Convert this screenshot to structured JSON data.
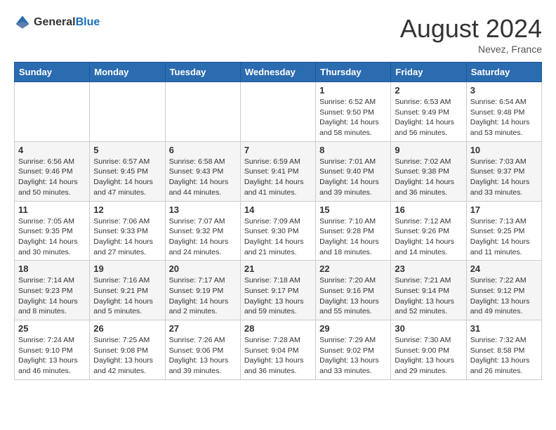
{
  "logo": {
    "general": "General",
    "blue": "Blue"
  },
  "header": {
    "month_year": "August 2024",
    "location": "Nevez, France"
  },
  "weekdays": [
    "Sunday",
    "Monday",
    "Tuesday",
    "Wednesday",
    "Thursday",
    "Friday",
    "Saturday"
  ],
  "weeks": [
    [
      {
        "day": "",
        "info": ""
      },
      {
        "day": "",
        "info": ""
      },
      {
        "day": "",
        "info": ""
      },
      {
        "day": "",
        "info": ""
      },
      {
        "day": "1",
        "info": "Sunrise: 6:52 AM\nSunset: 9:50 PM\nDaylight: 14 hours\nand 58 minutes."
      },
      {
        "day": "2",
        "info": "Sunrise: 6:53 AM\nSunset: 9:49 PM\nDaylight: 14 hours\nand 56 minutes."
      },
      {
        "day": "3",
        "info": "Sunrise: 6:54 AM\nSunset: 9:48 PM\nDaylight: 14 hours\nand 53 minutes."
      }
    ],
    [
      {
        "day": "4",
        "info": "Sunrise: 6:56 AM\nSunset: 9:46 PM\nDaylight: 14 hours\nand 50 minutes."
      },
      {
        "day": "5",
        "info": "Sunrise: 6:57 AM\nSunset: 9:45 PM\nDaylight: 14 hours\nand 47 minutes."
      },
      {
        "day": "6",
        "info": "Sunrise: 6:58 AM\nSunset: 9:43 PM\nDaylight: 14 hours\nand 44 minutes."
      },
      {
        "day": "7",
        "info": "Sunrise: 6:59 AM\nSunset: 9:41 PM\nDaylight: 14 hours\nand 41 minutes."
      },
      {
        "day": "8",
        "info": "Sunrise: 7:01 AM\nSunset: 9:40 PM\nDaylight: 14 hours\nand 39 minutes."
      },
      {
        "day": "9",
        "info": "Sunrise: 7:02 AM\nSunset: 9:38 PM\nDaylight: 14 hours\nand 36 minutes."
      },
      {
        "day": "10",
        "info": "Sunrise: 7:03 AM\nSunset: 9:37 PM\nDaylight: 14 hours\nand 33 minutes."
      }
    ],
    [
      {
        "day": "11",
        "info": "Sunrise: 7:05 AM\nSunset: 9:35 PM\nDaylight: 14 hours\nand 30 minutes."
      },
      {
        "day": "12",
        "info": "Sunrise: 7:06 AM\nSunset: 9:33 PM\nDaylight: 14 hours\nand 27 minutes."
      },
      {
        "day": "13",
        "info": "Sunrise: 7:07 AM\nSunset: 9:32 PM\nDaylight: 14 hours\nand 24 minutes."
      },
      {
        "day": "14",
        "info": "Sunrise: 7:09 AM\nSunset: 9:30 PM\nDaylight: 14 hours\nand 21 minutes."
      },
      {
        "day": "15",
        "info": "Sunrise: 7:10 AM\nSunset: 9:28 PM\nDaylight: 14 hours\nand 18 minutes."
      },
      {
        "day": "16",
        "info": "Sunrise: 7:12 AM\nSunset: 9:26 PM\nDaylight: 14 hours\nand 14 minutes."
      },
      {
        "day": "17",
        "info": "Sunrise: 7:13 AM\nSunset: 9:25 PM\nDaylight: 14 hours\nand 11 minutes."
      }
    ],
    [
      {
        "day": "18",
        "info": "Sunrise: 7:14 AM\nSunset: 9:23 PM\nDaylight: 14 hours\nand 8 minutes."
      },
      {
        "day": "19",
        "info": "Sunrise: 7:16 AM\nSunset: 9:21 PM\nDaylight: 14 hours\nand 5 minutes."
      },
      {
        "day": "20",
        "info": "Sunrise: 7:17 AM\nSunset: 9:19 PM\nDaylight: 14 hours\nand 2 minutes."
      },
      {
        "day": "21",
        "info": "Sunrise: 7:18 AM\nSunset: 9:17 PM\nDaylight: 13 hours\nand 59 minutes."
      },
      {
        "day": "22",
        "info": "Sunrise: 7:20 AM\nSunset: 9:16 PM\nDaylight: 13 hours\nand 55 minutes."
      },
      {
        "day": "23",
        "info": "Sunrise: 7:21 AM\nSunset: 9:14 PM\nDaylight: 13 hours\nand 52 minutes."
      },
      {
        "day": "24",
        "info": "Sunrise: 7:22 AM\nSunset: 9:12 PM\nDaylight: 13 hours\nand 49 minutes."
      }
    ],
    [
      {
        "day": "25",
        "info": "Sunrise: 7:24 AM\nSunset: 9:10 PM\nDaylight: 13 hours\nand 46 minutes."
      },
      {
        "day": "26",
        "info": "Sunrise: 7:25 AM\nSunset: 9:08 PM\nDaylight: 13 hours\nand 42 minutes."
      },
      {
        "day": "27",
        "info": "Sunrise: 7:26 AM\nSunset: 9:06 PM\nDaylight: 13 hours\nand 39 minutes."
      },
      {
        "day": "28",
        "info": "Sunrise: 7:28 AM\nSunset: 9:04 PM\nDaylight: 13 hours\nand 36 minutes."
      },
      {
        "day": "29",
        "info": "Sunrise: 7:29 AM\nSunset: 9:02 PM\nDaylight: 13 hours\nand 33 minutes."
      },
      {
        "day": "30",
        "info": "Sunrise: 7:30 AM\nSunset: 9:00 PM\nDaylight: 13 hours\nand 29 minutes."
      },
      {
        "day": "31",
        "info": "Sunrise: 7:32 AM\nSunset: 8:58 PM\nDaylight: 13 hours\nand 26 minutes."
      }
    ]
  ]
}
